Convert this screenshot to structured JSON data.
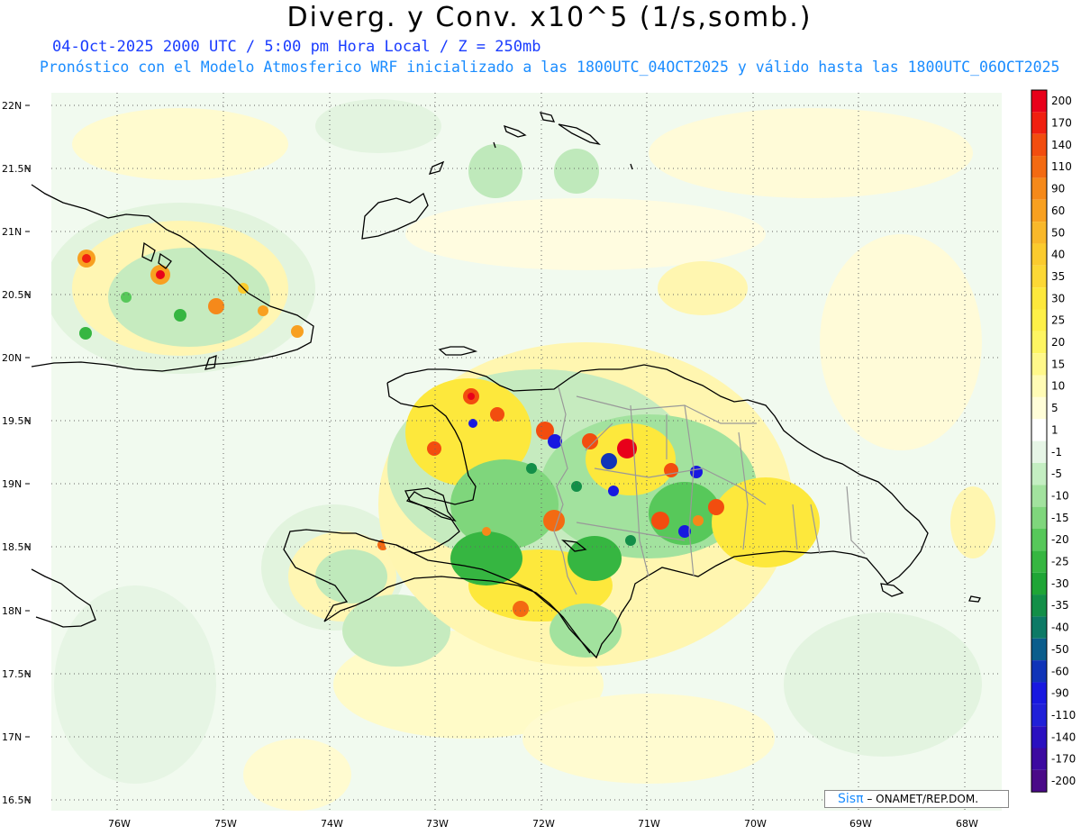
{
  "header": {
    "title": "Diverg. y Conv. x10^5 (1/s,somb.)",
    "subtitle_time": "04-Oct-2025  2000 UTC / 5:00 pm Hora Local / Z = 250mb",
    "subtitle_model": "Pronóstico con el Modelo Atmosferico WRF inicializado a las 1800UTC_04OCT2025 y válido hasta las  1800UTC_06OCT2025"
  },
  "axes": {
    "lat_labels": [
      "22N",
      "21.5N",
      "21N",
      "20.5N",
      "20N",
      "19.5N",
      "19N",
      "18.5N",
      "18N",
      "17.5N",
      "17N",
      "16.5N"
    ],
    "lon_labels": [
      "76W",
      "75W",
      "74W",
      "73W",
      "72W",
      "71W",
      "70W",
      "69W",
      "68W"
    ]
  },
  "colorbar": {
    "labels": [
      "200",
      "170",
      "140",
      "110",
      "90",
      "60",
      "50",
      "40",
      "35",
      "30",
      "25",
      "20",
      "15",
      "10",
      "5",
      "1",
      "-1",
      "-5",
      "-10",
      "-15",
      "-20",
      "-25",
      "-30",
      "-35",
      "-40",
      "-50",
      "-60",
      "-90",
      "-110",
      "-140",
      "-170",
      "-200"
    ],
    "colors": [
      "#e8001a",
      "#f02010",
      "#f24d0f",
      "#f36a12",
      "#f5891a",
      "#f8a020",
      "#f9b82a",
      "#fbcb2e",
      "#fcd835",
      "#fde83c",
      "#fef048",
      "#fef562",
      "#fff88a",
      "#fffbb5",
      "#fffdd8",
      "#ffffff",
      "#e6f5e6",
      "#c4eec2",
      "#a2e29e",
      "#7fd67c",
      "#57c85a",
      "#36b641",
      "#1fa536",
      "#138f48",
      "#0d7a66",
      "#0b5d8c",
      "#1034b8",
      "#1818e0",
      "#2020d8",
      "#2a10c0",
      "#3c0aa0",
      "#4a0a88"
    ]
  },
  "credit": {
    "brand": "Sisπ",
    "text": "– ONAMET/REP.DOM."
  }
}
